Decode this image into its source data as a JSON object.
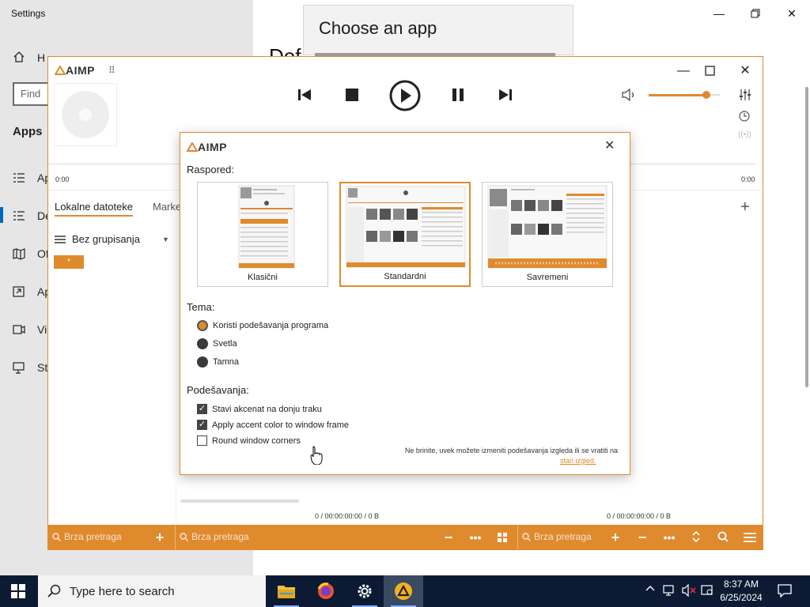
{
  "settings": {
    "title": "Settings",
    "home_label_partial": "H",
    "find_placeholder_partial": "Find",
    "section_title": "Apps",
    "main_title_partial": "Def",
    "nav_items": [
      {
        "label_partial": "Ap",
        "icon": "apps-list-icon"
      },
      {
        "label_partial": "De",
        "icon": "default-apps-icon"
      },
      {
        "label_partial": "Of",
        "icon": "offline-maps-icon"
      },
      {
        "label_partial": "Ap",
        "icon": "apps-websites-icon"
      },
      {
        "label_partial": "Vi",
        "icon": "video-playback-icon"
      },
      {
        "label_partial": "St",
        "icon": "startup-icon"
      }
    ]
  },
  "choose_app": {
    "title": "Choose an app"
  },
  "aimp": {
    "logo": "AIMP",
    "time_left": "0:00",
    "time_right": "0:00",
    "tabs": [
      {
        "label": "Lokalne datoteke"
      },
      {
        "label": "Marke"
      }
    ],
    "grouping_label": "Bez grupisanja",
    "star_chip": "*",
    "status_left": "0 / 00:00:00:00 / 0 B",
    "status_right": "0 / 00:00:00:00 / 0 B",
    "volume_level_percent": 80,
    "bottom_bar": {
      "search_placeholder": "Brza pretraga",
      "search_placeholder_2": "Brza pretraga",
      "search_placeholder_3": "Brza pretraga"
    }
  },
  "dialog": {
    "logo": "AIMP",
    "layout_heading": "Raspored:",
    "layouts": [
      {
        "label": "Klasični",
        "selected": false
      },
      {
        "label": "Standardni",
        "selected": true
      },
      {
        "label": "Savremeni",
        "selected": false
      }
    ],
    "theme_heading": "Tema:",
    "themes": [
      {
        "label": "Koristi podešavanja programa",
        "selected": true
      },
      {
        "label": "Svetla",
        "selected": false
      },
      {
        "label": "Tamna",
        "selected": false
      }
    ],
    "settings_heading": "Podešavanja:",
    "options": [
      {
        "label": "Stavi akcenat na donju traku",
        "checked": true
      },
      {
        "label": "Apply accent color to window frame",
        "checked": true
      },
      {
        "label": "Round window corners",
        "checked": false
      }
    ],
    "note": "Ne brinite, uvek možete izmeniti podešavanja izgleda ili se vratiti na",
    "note_link": "stari izgled."
  },
  "taskbar": {
    "search_placeholder": "Type here to search",
    "time": "8:37 AM",
    "date": "6/25/2024"
  },
  "colors": {
    "accent": "#e08a2e",
    "taskbar": "#0c1b33"
  }
}
